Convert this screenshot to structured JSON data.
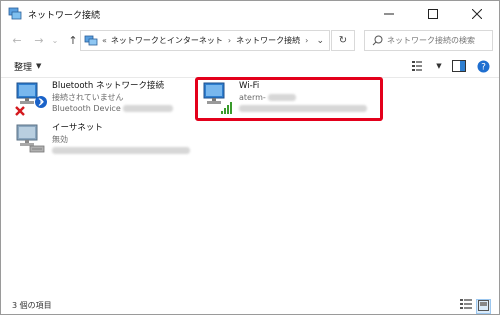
{
  "window": {
    "title": "ネットワーク接続",
    "controls": [
      "minimize",
      "maximize",
      "close"
    ]
  },
  "nav": {
    "breadcrumb": [
      "«",
      "ネットワークとインターネット",
      "ネットワーク接続"
    ],
    "search_placeholder": "ネットワーク接続の検索"
  },
  "toolbar": {
    "organize_label": "整理"
  },
  "connections": [
    {
      "name": "Bluetooth ネットワーク接続",
      "status": "接続されていません",
      "device": "Bluetooth Device",
      "icon": "bluetooth-network-icon"
    },
    {
      "name": "Wi-Fi",
      "status": "aterm-",
      "device": "",
      "icon": "wifi-network-icon"
    },
    {
      "name": "イーサネット",
      "status": "無効",
      "device": "",
      "icon": "ethernet-network-icon"
    }
  ],
  "status_bar": {
    "item_count": "3 個の項目"
  },
  "colors": {
    "highlight": "#e3001b",
    "monitor": "#2f7fd0",
    "signal": "#3a9b2c",
    "error": "#d4191e"
  }
}
